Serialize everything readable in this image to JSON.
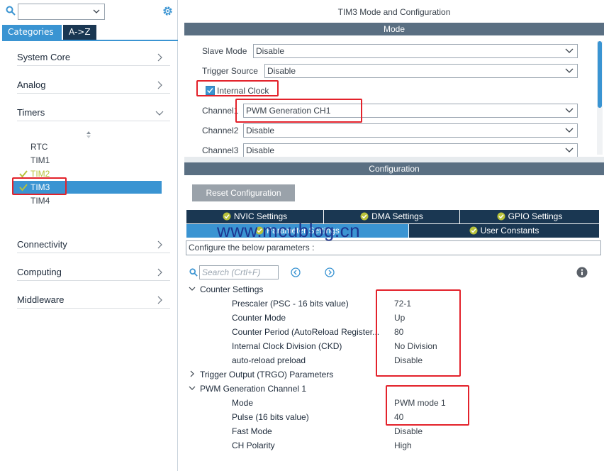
{
  "left": {
    "tabs": {
      "categories": "Categories",
      "az": "A->Z"
    },
    "categories": [
      {
        "label": "System Core"
      },
      {
        "label": "Analog"
      },
      {
        "label": "Timers"
      },
      {
        "label": "Connectivity"
      },
      {
        "label": "Computing"
      },
      {
        "label": "Middleware"
      }
    ],
    "timers": [
      "RTC",
      "TIM1",
      "TIM2",
      "TIM3",
      "TIM4"
    ]
  },
  "right": {
    "title": "TIM3 Mode and Configuration",
    "mode_bar": "Mode",
    "mode": {
      "slave_mode": {
        "label": "Slave Mode",
        "value": "Disable"
      },
      "trigger_source": {
        "label": "Trigger Source",
        "value": "Disable"
      },
      "internal_clock": {
        "label": "Internal Clock",
        "checked": true
      },
      "channel1": {
        "label": "Channel1",
        "value": "PWM Generation CH1"
      },
      "channel2": {
        "label": "Channel2",
        "value": "Disable"
      },
      "channel3": {
        "label": "Channel3",
        "value": "Disable"
      }
    },
    "config_bar": "Configuration",
    "reset_label": "Reset Configuration",
    "tabs": {
      "nvic": "NVIC Settings",
      "dma": "DMA Settings",
      "gpio": "GPIO Settings",
      "params": "Parameter Settings",
      "user": "User Constants"
    },
    "hint": "Configure the below parameters :",
    "search_placeholder": "Search (Crtl+F)",
    "groups": {
      "counter": "Counter Settings",
      "trgo": "Trigger Output (TRGO) Parameters",
      "pwm": "PWM Generation Channel 1"
    },
    "counter_rows": [
      {
        "k": "Prescaler (PSC - 16 bits value)",
        "v": "72-1"
      },
      {
        "k": "Counter Mode",
        "v": "Up"
      },
      {
        "k": "Counter Period (AutoReload Register...",
        "v": "80"
      },
      {
        "k": "Internal Clock Division (CKD)",
        "v": "No Division"
      },
      {
        "k": "auto-reload preload",
        "v": "Disable"
      }
    ],
    "pwm_rows": [
      {
        "k": "Mode",
        "v": "PWM mode 1"
      },
      {
        "k": "Pulse (16 bits value)",
        "v": "40"
      },
      {
        "k": "Fast Mode",
        "v": "Disable"
      },
      {
        "k": "CH Polarity",
        "v": "High"
      }
    ],
    "watermark": "www.mcublog.cn"
  },
  "colors": {
    "accent": "#3a94d2",
    "dark_tab": "#1a3752",
    "bar": "#5a6f82",
    "highlight": "#e3222b",
    "check": "#b8c23a"
  },
  "icons": [
    "search-icon",
    "gear-icon",
    "chevron-down-icon",
    "chevron-right-icon",
    "check-icon",
    "info-icon",
    "prev-icon",
    "next-icon"
  ]
}
